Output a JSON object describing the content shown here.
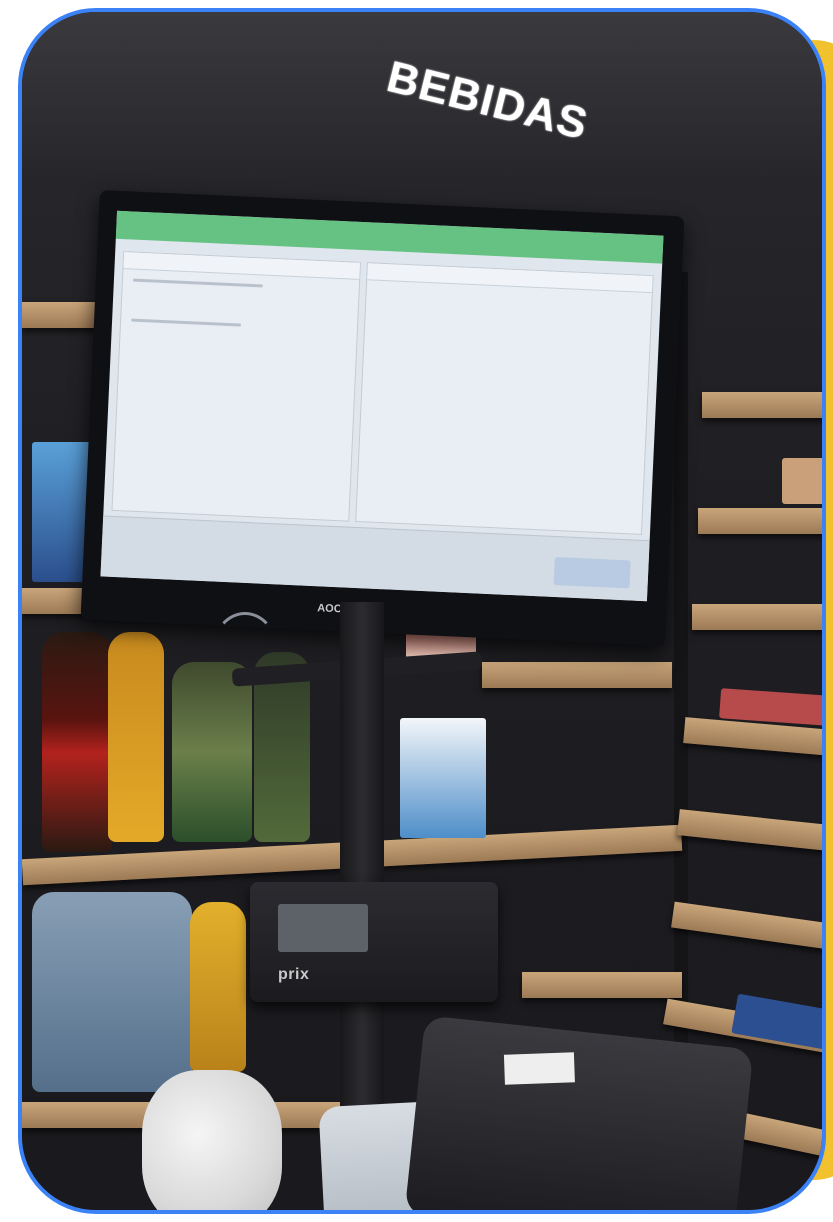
{
  "scene": {
    "sign_text": "BEBIDAS",
    "monitor_brand": "AOC",
    "scanner_brand": "prix"
  },
  "colors": {
    "frame_border": "#3b82f6",
    "accent": "#f2c12e",
    "pos_title_bar": "#3cb55d"
  },
  "icons": {
    "monitor": "pos-monitor-icon",
    "scanner": "barcode-scanner-icon",
    "printer": "receipt-printer-icon"
  }
}
